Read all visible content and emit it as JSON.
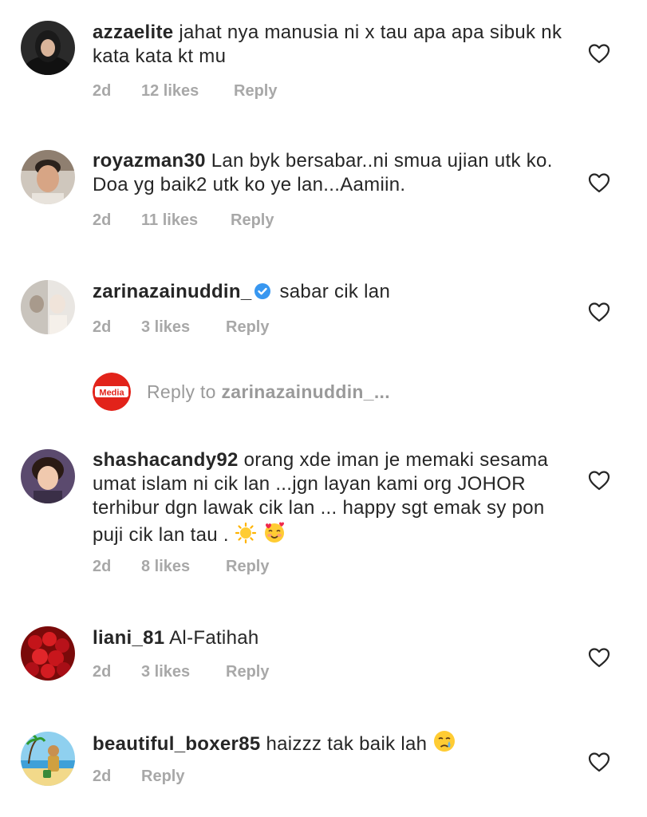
{
  "comments": [
    {
      "username": "azzaelite",
      "text": "jahat nya manusia ni x tau apa apa sibuk nk kata kata kt mu",
      "time": "2d",
      "likes": "12 likes",
      "reply_label": "Reply"
    },
    {
      "username": "royazman30",
      "text": "Lan byk bersabar..ni smua ujian utk ko. Doa yg baik2 utk ko ye lan...Aamiin.",
      "time": "2d",
      "likes": "11 likes",
      "reply_label": "Reply"
    },
    {
      "username": "zarinazainuddin_",
      "text": "sabar cik lan",
      "time": "2d",
      "likes": "3 likes",
      "reply_label": "Reply"
    },
    {
      "username": "shashacandy92",
      "text": "orang xde iman je memaki sesama umat islam ni cik lan ...jgn layan kami org JOHOR terhibur dgn lawak cik lan ... happy sgt emak sy pon puji cik lan tau .",
      "time": "2d",
      "likes": "8 likes",
      "reply_label": "Reply"
    },
    {
      "username": "liani_81",
      "text": "Al-Fatihah",
      "time": "2d",
      "likes": "3 likes",
      "reply_label": "Reply"
    },
    {
      "username": "beautiful_boxer85",
      "text": "haizzz tak baik lah",
      "time": "2d",
      "reply_label": "Reply"
    }
  ],
  "reply_box": {
    "avatar_text": "Media",
    "prefix": "Reply to ",
    "mention": "zarinazainuddin_..."
  },
  "icons": {
    "like": "heart-outline-icon",
    "verified": "verified-badge-icon",
    "emoji_sun": "sun-emoji-icon",
    "emoji_love": "smiling-face-with-hearts-emoji-icon",
    "emoji_cry": "crying-face-emoji-icon"
  },
  "colors": {
    "text": "#262626",
    "meta": "#a8a8a8",
    "verified": "#3897f0",
    "media_red": "#e2231a"
  }
}
